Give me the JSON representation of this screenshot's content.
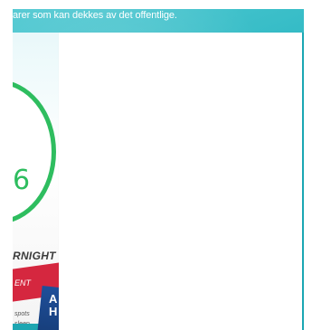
{
  "banner": {
    "text": "arer som kan dekkes av det offentlige."
  },
  "product": {
    "badge_glyph": "6",
    "overnight_label": "RNIGHT",
    "red_strip_text": "ENT",
    "small_copy": [
      "spots",
      "sleep",
      "me"
    ],
    "blue_box_letters": [
      "A",
      "H"
    ]
  },
  "colors": {
    "teal": "#2bb7c2",
    "green": "#2ebd5f",
    "red": "#d5273f",
    "blue": "#1f4f9a"
  }
}
